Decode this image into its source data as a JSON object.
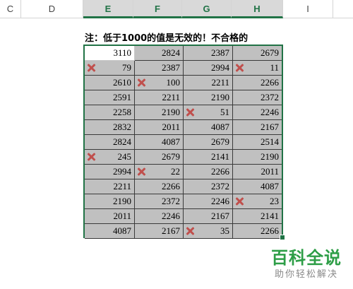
{
  "columns": [
    "C",
    "D",
    "E",
    "F",
    "G",
    "H",
    "I"
  ],
  "note": "注：低于1000的值是无效的！不合格的",
  "rows": [
    [
      {
        "v": "3110",
        "bad": false
      },
      {
        "v": "2824",
        "bad": false
      },
      {
        "v": "2387",
        "bad": false
      },
      {
        "v": "2679",
        "bad": false
      }
    ],
    [
      {
        "v": "79",
        "bad": true
      },
      {
        "v": "2387",
        "bad": false
      },
      {
        "v": "2994",
        "bad": false
      },
      {
        "v": "11",
        "bad": true
      }
    ],
    [
      {
        "v": "2610",
        "bad": false
      },
      {
        "v": "100",
        "bad": true
      },
      {
        "v": "2211",
        "bad": false
      },
      {
        "v": "2266",
        "bad": false
      }
    ],
    [
      {
        "v": "2591",
        "bad": false
      },
      {
        "v": "2211",
        "bad": false
      },
      {
        "v": "2190",
        "bad": false
      },
      {
        "v": "2372",
        "bad": false
      }
    ],
    [
      {
        "v": "2258",
        "bad": false
      },
      {
        "v": "2190",
        "bad": false
      },
      {
        "v": "51",
        "bad": true
      },
      {
        "v": "2246",
        "bad": false
      }
    ],
    [
      {
        "v": "2832",
        "bad": false
      },
      {
        "v": "2011",
        "bad": false
      },
      {
        "v": "4087",
        "bad": false
      },
      {
        "v": "2167",
        "bad": false
      }
    ],
    [
      {
        "v": "2824",
        "bad": false
      },
      {
        "v": "4087",
        "bad": false
      },
      {
        "v": "2679",
        "bad": false
      },
      {
        "v": "2514",
        "bad": false
      }
    ],
    [
      {
        "v": "245",
        "bad": true
      },
      {
        "v": "2679",
        "bad": false
      },
      {
        "v": "2141",
        "bad": false
      },
      {
        "v": "2190",
        "bad": false
      }
    ],
    [
      {
        "v": "2994",
        "bad": false
      },
      {
        "v": "22",
        "bad": true
      },
      {
        "v": "2266",
        "bad": false
      },
      {
        "v": "2011",
        "bad": false
      }
    ],
    [
      {
        "v": "2211",
        "bad": false
      },
      {
        "v": "2266",
        "bad": false
      },
      {
        "v": "2372",
        "bad": false
      },
      {
        "v": "4087",
        "bad": false
      }
    ],
    [
      {
        "v": "2190",
        "bad": false
      },
      {
        "v": "2372",
        "bad": false
      },
      {
        "v": "2246",
        "bad": false
      },
      {
        "v": "23",
        "bad": true
      }
    ],
    [
      {
        "v": "2011",
        "bad": false
      },
      {
        "v": "2246",
        "bad": false
      },
      {
        "v": "2167",
        "bad": false
      },
      {
        "v": "2141",
        "bad": false
      }
    ],
    [
      {
        "v": "4087",
        "bad": false
      },
      {
        "v": "2167",
        "bad": false
      },
      {
        "v": "35",
        "bad": true
      },
      {
        "v": "2266",
        "bad": false
      }
    ]
  ],
  "watermark": {
    "title": "百科全说",
    "subtitle": "助你轻松解决"
  },
  "colors": {
    "accent": "#217346",
    "cell_fill": "#c0c0c0",
    "error_mark": "#c0504d",
    "watermark_green": "#2e9e47"
  },
  "icons": {
    "error": "cross-mark-icon"
  }
}
